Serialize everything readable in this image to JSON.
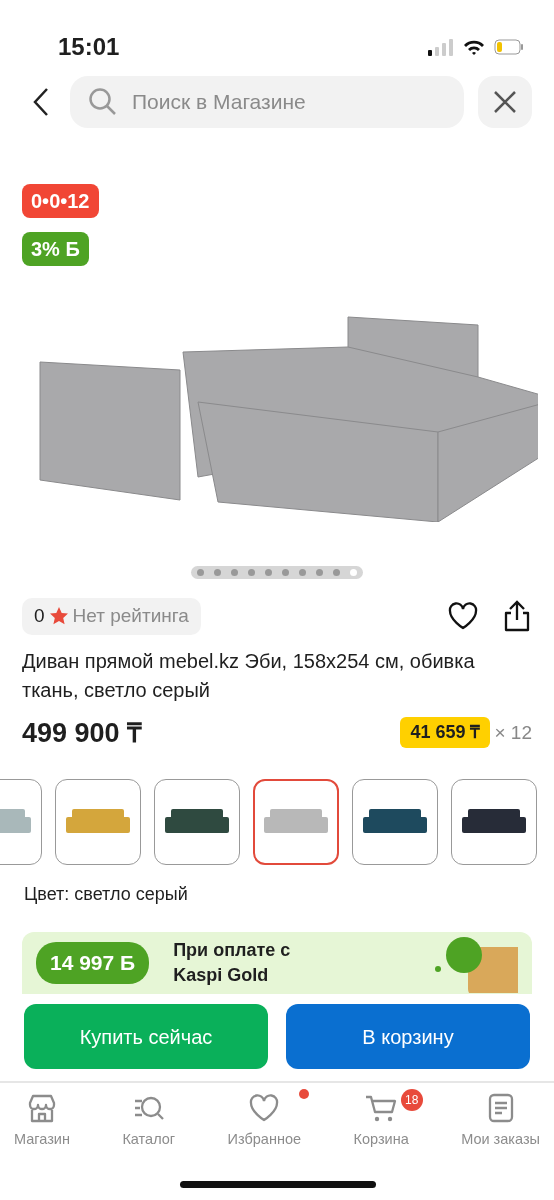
{
  "status_bar": {
    "time": "15:01"
  },
  "header": {
    "search": {
      "placeholder": "Поиск в Магазине"
    }
  },
  "gallery": {
    "badges": [
      {
        "kind": "installment",
        "text": "0•0•12"
      },
      {
        "kind": "bonus",
        "text": "3% Б"
      }
    ],
    "dots": [
      {
        "selected": false
      },
      {
        "selected": false
      },
      {
        "selected": false
      },
      {
        "selected": false
      },
      {
        "selected": false
      },
      {
        "selected": false
      },
      {
        "selected": false
      },
      {
        "selected": false
      },
      {
        "selected": false
      },
      {
        "selected": true
      }
    ]
  },
  "rating": {
    "score": "0",
    "label": "Нет рейтинга"
  },
  "product": {
    "title": "Диван прямой mebel.kz Эби, 158x254 см, обивка ткань, светло серый",
    "price": "499 900 ₸",
    "monthly": "41 659 ₸",
    "months": "× 12"
  },
  "variants": [
    {
      "color": "#a9b8ba",
      "selected": false
    },
    {
      "color": "#d4a63c",
      "selected": false
    },
    {
      "color": "#2f4a40",
      "selected": false
    },
    {
      "color": "#b8b8b8",
      "selected": true
    },
    {
      "color": "#1e4a5e",
      "selected": false
    },
    {
      "color": "#272c38",
      "selected": false
    }
  ],
  "color_label": "Цвет: светло серый",
  "promo": {
    "amount": "14 997 Б",
    "text": "При оплате с Kaspi Gold"
  },
  "actions": [
    {
      "kind": "buy",
      "label": "Купить сейчас"
    },
    {
      "kind": "cart",
      "label": "В корзину"
    }
  ],
  "tab_bar": [
    {
      "kind": "store",
      "label": "Магазин",
      "selected": false,
      "dot": false
    },
    {
      "kind": "catalog",
      "label": "Каталог",
      "selected": false,
      "dot": false
    },
    {
      "kind": "heart",
      "label": "Избранное",
      "selected": false,
      "dot": true
    },
    {
      "kind": "cart",
      "label": "Корзина",
      "selected": false,
      "dot": false,
      "badge": "18"
    },
    {
      "kind": "orders",
      "label": "Мои заказы",
      "selected": false,
      "dot": false
    }
  ]
}
